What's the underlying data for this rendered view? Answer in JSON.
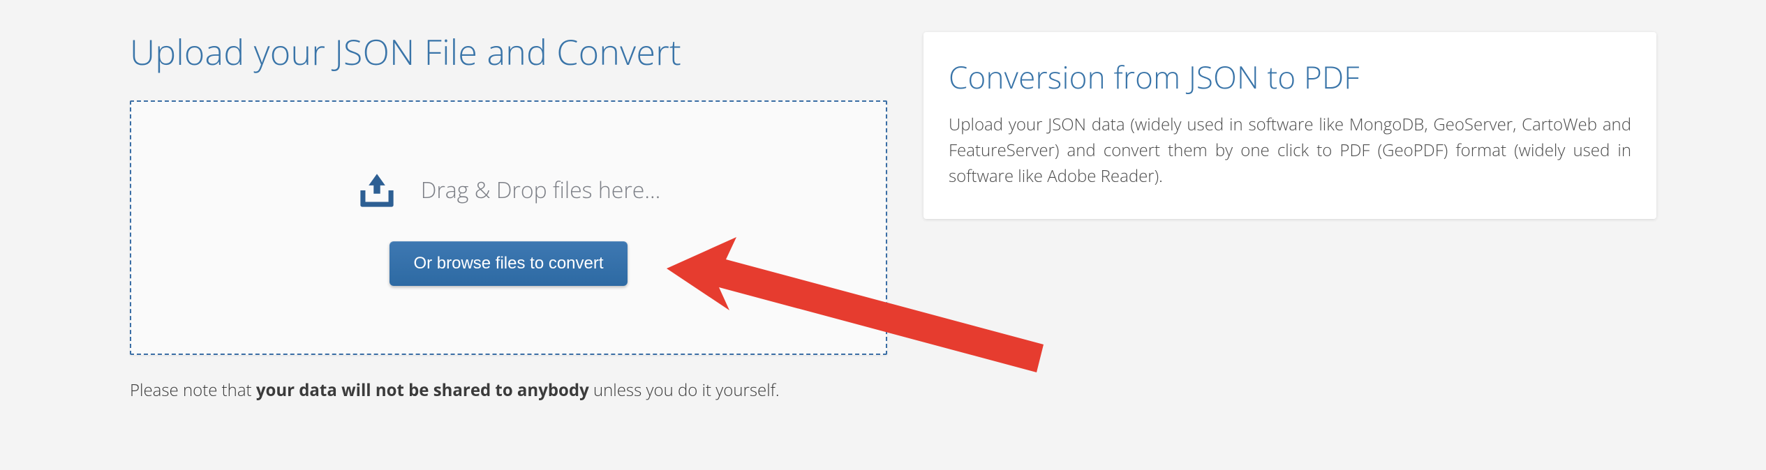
{
  "page": {
    "title": "Upload your JSON File and Convert"
  },
  "dropzone": {
    "label": "Drag & Drop files here...",
    "button": "Or browse files to convert"
  },
  "note": {
    "prefix": "Please note that ",
    "bold": "your data will not be shared to anybody",
    "suffix": " unless you do it yourself."
  },
  "info": {
    "title": "Conversion from JSON to PDF",
    "body": "Upload your JSON data (widely used in software like MongoDB, GeoServer, CartoWeb and FeatureServer) and convert them by one click to PDF (GeoPDF) format (widely used in software like Adobe Reader)."
  }
}
